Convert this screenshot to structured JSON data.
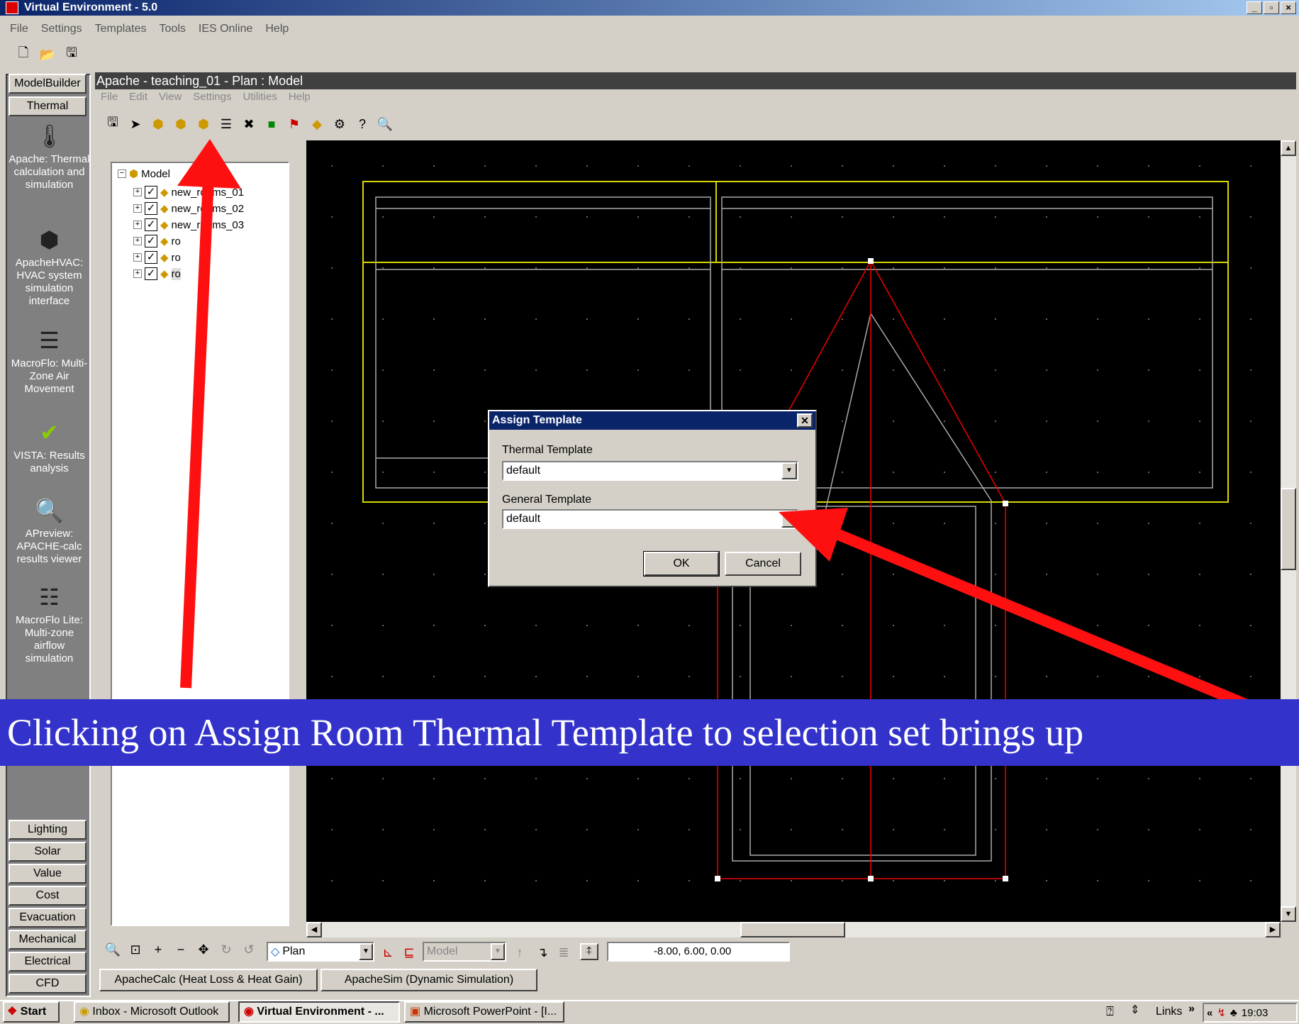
{
  "app": {
    "title": "Virtual Environment - 5.0"
  },
  "main_menu": [
    "File",
    "Settings",
    "Templates",
    "Tools",
    "IES Online",
    "Help"
  ],
  "sidebar": {
    "top_tabs": [
      {
        "label": "ModelBuilder"
      },
      {
        "label": "Thermal"
      }
    ],
    "tools": [
      {
        "icon": "thermometer-icon",
        "label": "Apache: Thermal calculation and simulation"
      },
      {
        "icon": "hvac-icon",
        "label": "ApacheHVAC: HVAC system simulation interface"
      },
      {
        "icon": "macroflo-icon",
        "label": "MacroFlo: Multi-Zone Air Movement"
      },
      {
        "icon": "checkmark-chart-icon",
        "label": "VISTA: Results analysis"
      },
      {
        "icon": "magnifier-document-icon",
        "label": "APreview: APACHE-calc results viewer"
      },
      {
        "icon": "macroflo-lite-icon",
        "label": "MacroFlo Lite: Multi-zone airflow simulation"
      }
    ],
    "bottom_tabs": [
      {
        "label": "Lighting"
      },
      {
        "label": "Solar"
      },
      {
        "label": "Value"
      },
      {
        "label": "Cost"
      },
      {
        "label": "Evacuation"
      },
      {
        "label": "Mechanical"
      },
      {
        "label": "Electrical"
      },
      {
        "label": "CFD"
      }
    ]
  },
  "child_window": {
    "title": "Apache - teaching_01 - Plan : Model",
    "menu": [
      "File",
      "Edit",
      "View",
      "Settings",
      "Utilities",
      "Help"
    ]
  },
  "tree": {
    "root": "Model",
    "items": [
      "new_rooms_01",
      "new_rooms_02",
      "new_rooms_03",
      "ro",
      "ro",
      "ro"
    ]
  },
  "dialog": {
    "title": "Assign Template",
    "thermal_label": "Thermal Template",
    "thermal_value": "default",
    "general_label": "General Template",
    "general_value": "default",
    "ok": "OK",
    "cancel": "Cancel"
  },
  "caption": "Clicking on Assign Room Thermal Template  to selection set brings up",
  "bottom_toolbar": {
    "view_select": "Plan",
    "layer_select": "Model",
    "coords": "-8.00,  6.00,  0.00"
  },
  "bottom_tabs": [
    "ApacheCalc (Heat Loss & Heat Gain)",
    "ApacheSim (Dynamic Simulation)"
  ],
  "taskbar": {
    "start": "Start",
    "tasks": [
      "Inbox - Microsoft Outlook",
      "Virtual Environment - ...",
      "Microsoft PowerPoint - [I..."
    ],
    "links": "Links",
    "clock": "19:03"
  },
  "colors": {
    "arrow": "#ff1010",
    "caption_bg": "#3333cc",
    "canvas": "#000000",
    "titlebar": "#0a246a"
  }
}
